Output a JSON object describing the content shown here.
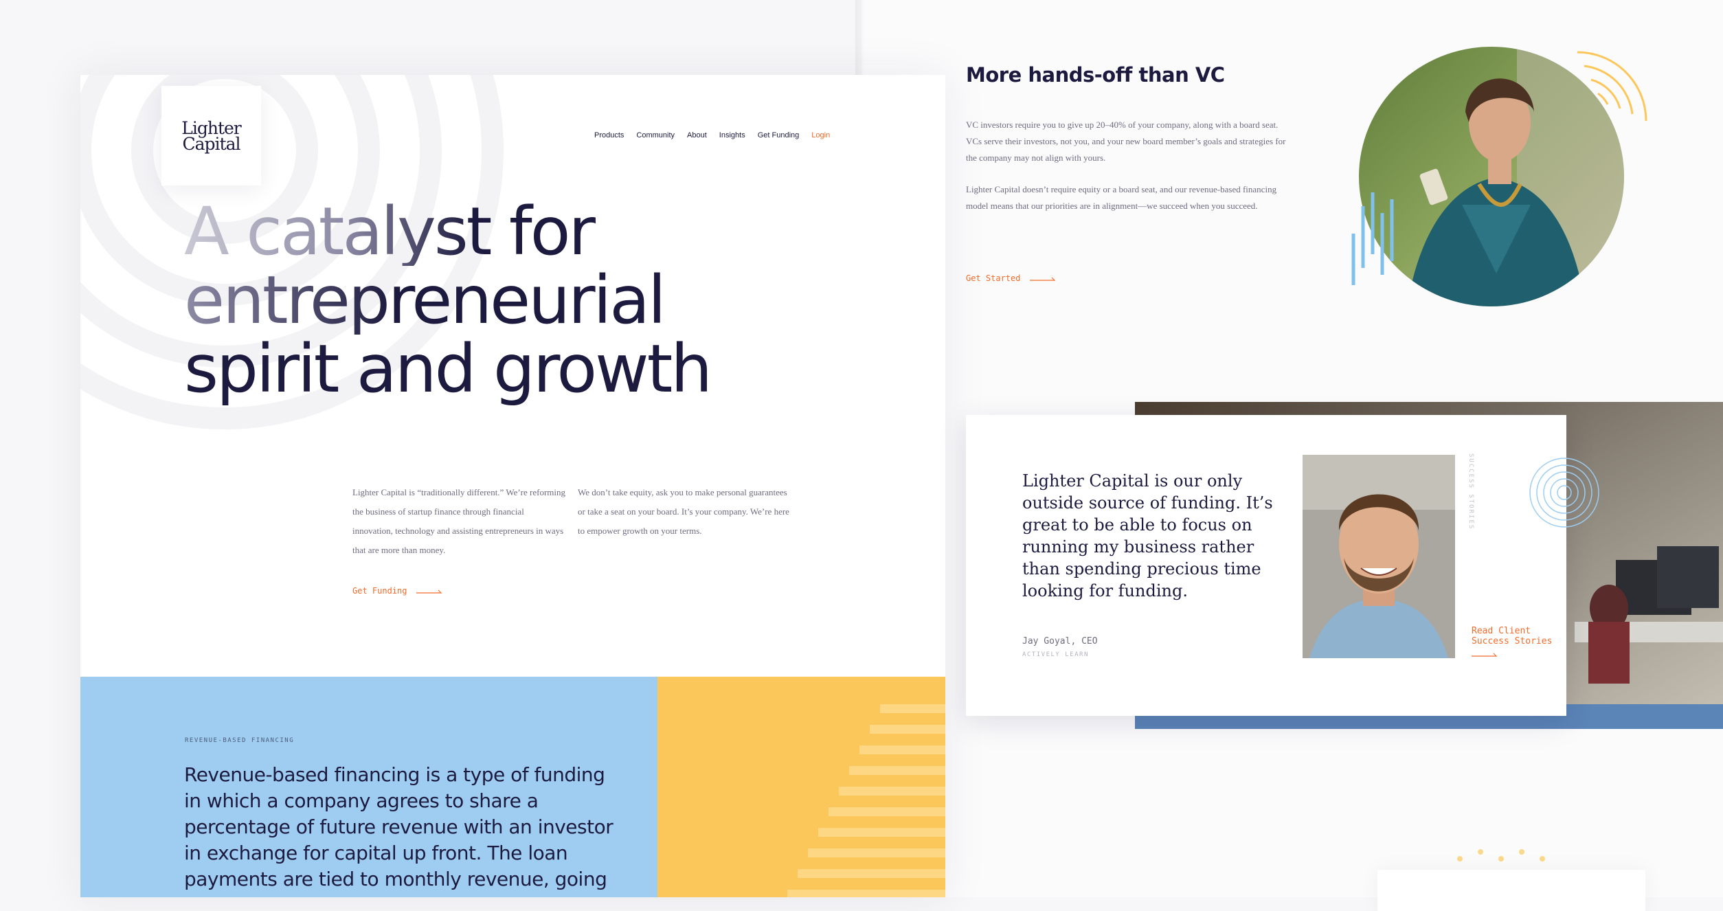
{
  "brand": {
    "logo_line1": "Lighter",
    "logo_line2": "Capital"
  },
  "nav": {
    "items": [
      "Products",
      "Community",
      "About",
      "Insights",
      "Get Funding"
    ],
    "login": "Login"
  },
  "hero": {
    "line1": "A catalyst for",
    "line2": "entrepreneurial",
    "line3": "spirit and growth"
  },
  "intro": {
    "col1": "Lighter Capital is “traditionally different.” We’re reforming the business of startup finance through financial innovation, technology and assisting entrepreneurs in ways that are more than money.",
    "col2": "We don’t take equity, ask you to make personal guarantees or take a seat on your board. It’s your company. We’re here to empower growth on your terms.",
    "cta": "Get Funding"
  },
  "rbf": {
    "kicker": "REVENUE-BASED FINANCING",
    "text": "Revenue-based financing is a type of funding in which a company agrees to share a percentage of future revenue with an investor in exchange for capital up front. The loan payments are tied to monthly revenue, going"
  },
  "vc": {
    "title": "More hands-off than VC",
    "p1": "VC investors require you to give up 20–40% of your company, along with a board seat. VCs serve their investors, not you, and your new board member’s goals and strategies for the company may not align with yours.",
    "p2": "Lighter Capital doesn’t require equity or a board seat, and our revenue-based financing model means that our priorities are in alignment—we succeed when you succeed.",
    "cta": "Get Started"
  },
  "testimonial": {
    "quote": "Lighter Capital is our only outside source of funding. It’s great to be able to focus on running my business rather than spending precious time looking for funding.",
    "name": "Jay Goyal, CEO",
    "company": "ACTIVELY LEARN",
    "section_label": "SUCCESS STORIES",
    "link": "Read Client Success Stories"
  },
  "colors": {
    "navy": "#1c1a3e",
    "accent": "#f26b2a",
    "blue": "#9ecdf1",
    "yellow": "#fcc75a",
    "gray_text": "#6d6b80"
  },
  "icons": [
    "right-arrow-icon",
    "concentric-rings-icon",
    "bar-lines-icon",
    "dot-grid-icon"
  ]
}
